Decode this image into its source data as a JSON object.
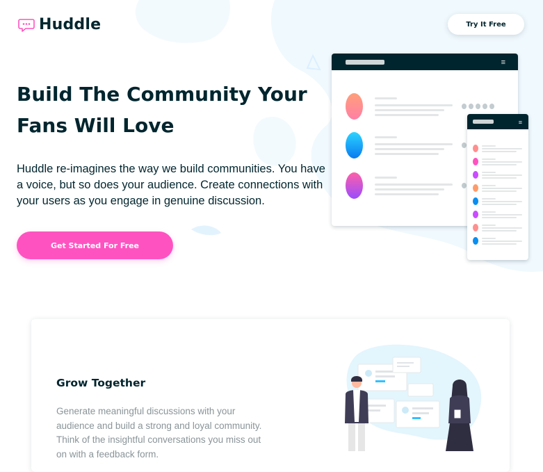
{
  "brand": {
    "name": "Huddle",
    "logo_icon": "chat-bubble-icon",
    "accent": "#ff52c1",
    "dark": "#00252e"
  },
  "header": {
    "try_button": "Try It Free"
  },
  "hero": {
    "title": "Build The Community Your Fans Will Love",
    "text": "Huddle re-imagines the way we build communities. You have a voice, but so does your audience. Create connections with your users as you engage in genuine discussion.",
    "cta": "Get Started For Free"
  },
  "features": [
    {
      "title": "Grow Together",
      "text": "Generate meaningful discussions with your audience and build a strong and loyal community. Think of the insightful conversations you miss out on with a feedback form."
    }
  ]
}
